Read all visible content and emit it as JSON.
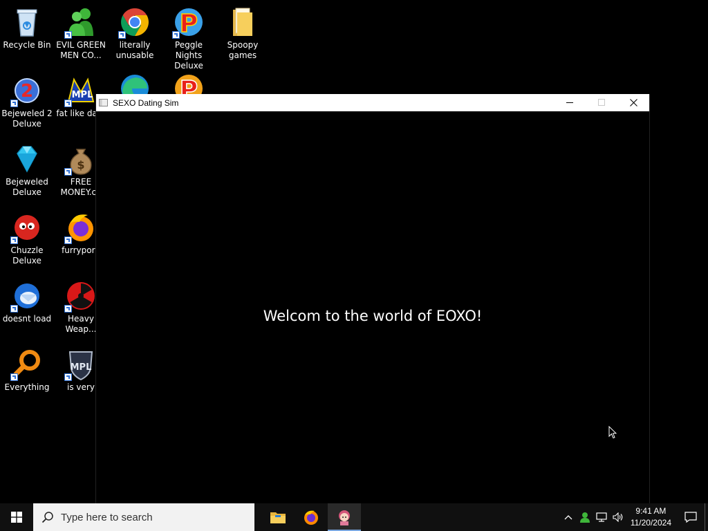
{
  "desktop": {
    "icons": [
      {
        "label": "Recycle Bin"
      },
      {
        "label": "EVIL GREEN MEN CO..."
      },
      {
        "label": "literally unusable"
      },
      {
        "label": "Peggle Nights Deluxe"
      },
      {
        "label": "Spoopy games"
      },
      {
        "label": "Bejeweled 2 Deluxe"
      },
      {
        "label": "fat like dark"
      },
      {
        "label": "Bejeweled Deluxe"
      },
      {
        "label": "FREE MONEY.co"
      },
      {
        "label": "Chuzzle Deluxe"
      },
      {
        "label": "furryporn"
      },
      {
        "label": "doesnt load"
      },
      {
        "label": "Heavy Weap..."
      },
      {
        "label": "Everything"
      },
      {
        "label": "is very"
      }
    ]
  },
  "window": {
    "title": "SEXO Dating Sim",
    "welcome_text": "Welcom to the world of EOXO!"
  },
  "taskbar": {
    "search_placeholder": "Type here to search",
    "apps": [
      "file-explorer",
      "firefox",
      "sexo-dating-sim"
    ],
    "time": "9:41 AM",
    "date": "11/20/2024"
  },
  "colors": {
    "taskbar_bg": "#101010",
    "accent": "#7aa7e0",
    "window_bg": "#000000"
  }
}
